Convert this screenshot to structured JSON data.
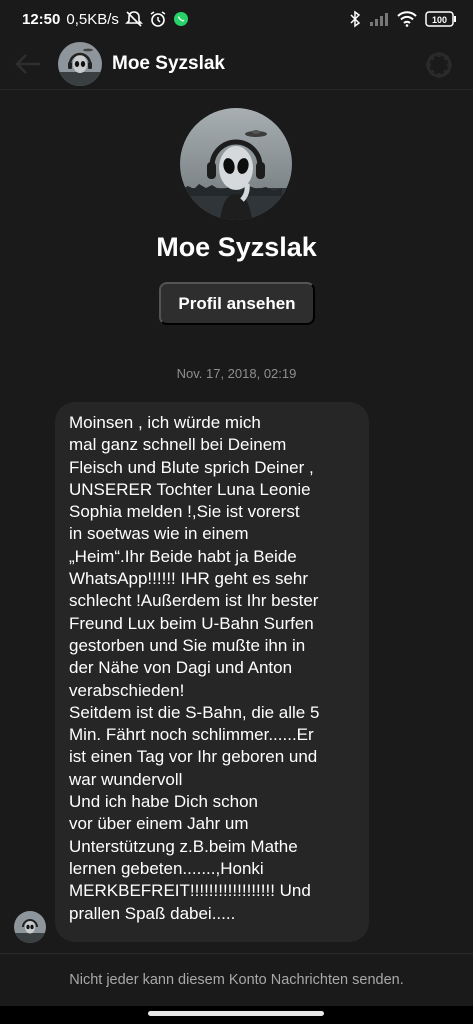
{
  "status_bar": {
    "time": "12:50",
    "speed": "0,5KB/s",
    "battery": "100",
    "icons": [
      "mute-icon",
      "alarm-icon",
      "whatsapp-icon",
      "bluetooth-icon",
      "signal-icon",
      "wifi-icon",
      "battery-icon"
    ],
    "accent_green": "#25d366"
  },
  "header": {
    "name": "Moe Syzslak"
  },
  "profile": {
    "name": "Moe Syzslak",
    "view_profile_label": "Profil ansehen"
  },
  "conversation": {
    "timestamp": "Nov. 17, 2018, 02:19",
    "message": "Moinsen , ich würde mich\nmal ganz schnell bei Deinem\nFleisch und Blute sprich Deiner ,\nUNSERER Tochter Luna Leonie\nSophia melden !,Sie ist vorerst\nin soetwas wie in einem\n„Heim“.Ihr Beide habt ja Beide\nWhatsApp!!!!!! IHR geht  es sehr\nschlecht !Außerdem ist Ihr bester\nFreund Lux beim U-Bahn Surfen\ngestorben und Sie mußte ihn in\nder Nähe von Dagi und Anton\nverabschieden!\nSeitdem ist die S-Bahn, die alle 5\nMin. Fährt noch schlimmer......Er\nist einen Tag vor Ihr geboren und\nwar wundervoll\nUnd ich habe Dich schon\nvor über einem Jahr um\nUnterstützung z.B.beim Mathe\nlernen gebeten.......,Honki\nMERKBEFREIT!!!!!!!!!!!!!!!!!! Und\nprallen Spaß dabei....."
  },
  "footer": {
    "note": "Nicht jeder kann diesem Konto Nachrichten senden."
  }
}
